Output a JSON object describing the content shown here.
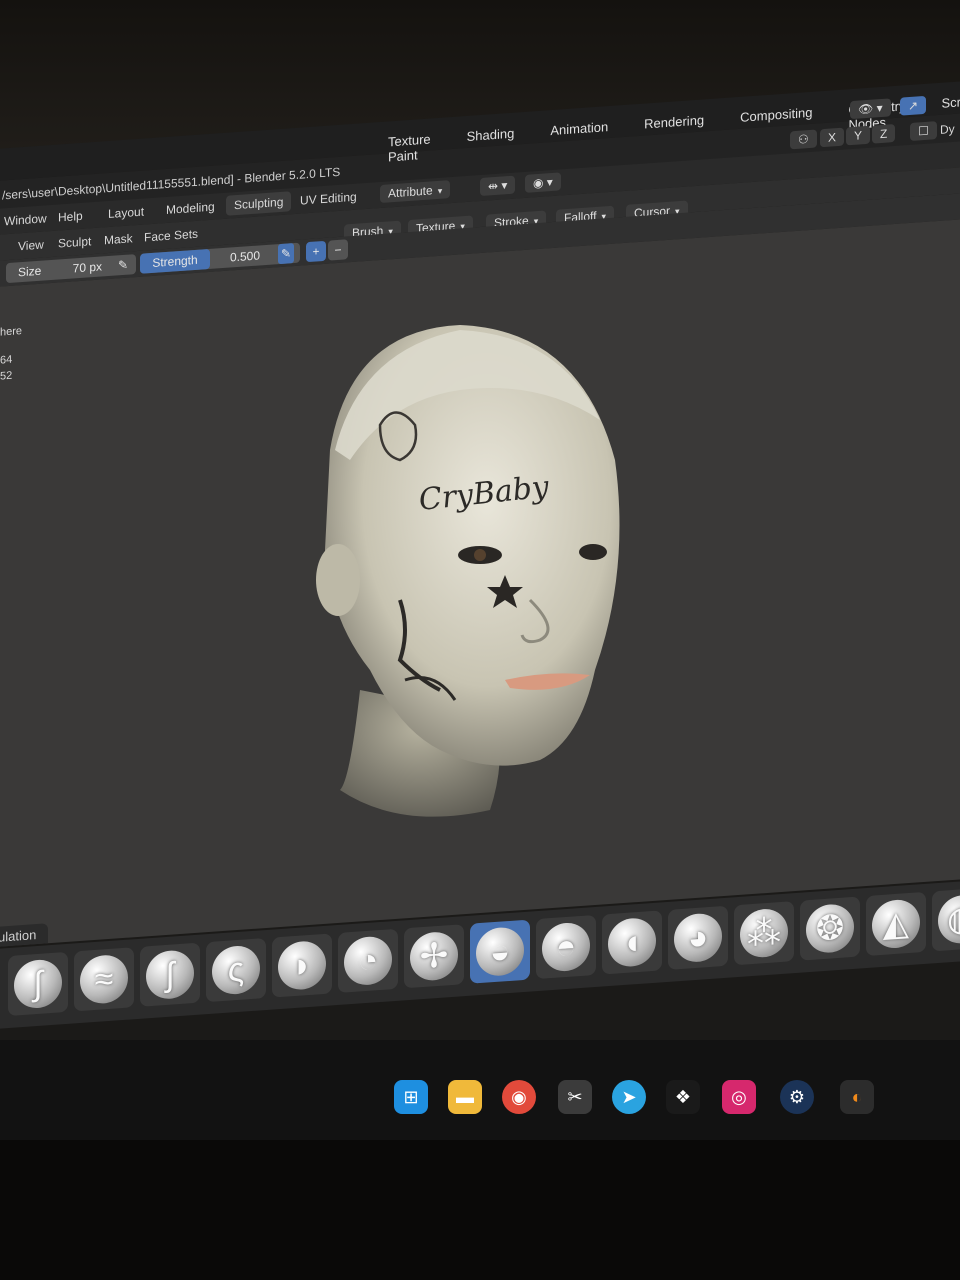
{
  "window": {
    "title": "/sers\\user\\Desktop\\Untitled11155551.blend] - Blender 5.2.0 LTS"
  },
  "workspace_tabs": [
    "Layout",
    "Modeling",
    "Sculpting",
    "UV Editing",
    "Texture Paint",
    "Shading",
    "Animation",
    "Rendering",
    "Compositing",
    "Geometry Nodes",
    "Scripting"
  ],
  "menu": {
    "window": "Window",
    "help": "Help"
  },
  "header": {
    "attribute": "Attribute",
    "axes": [
      "X",
      "Y",
      "Z"
    ],
    "dyntopo": "Dy"
  },
  "mode_menu": [
    "View",
    "Sculpt",
    "Mask",
    "Face Sets"
  ],
  "toolbar": {
    "size_label": "Size",
    "size_value": "70 px",
    "strength_label": "Strength",
    "strength_value": "0.500",
    "plus": "+",
    "minus": "−",
    "brush": "Brush",
    "texture": "Texture",
    "stroke": "Stroke",
    "falloff": "Falloff",
    "cursor": "Cursor"
  },
  "side_panel": {
    "line1": "here",
    "line2": "64",
    "line3": "52"
  },
  "viewport": {
    "tattoo_text": "CryBaby"
  },
  "asset_shelf": {
    "tab_label": "ulation",
    "brush_icons": [
      "snake-hook-icon",
      "draw-sharp-icon",
      "elastic-deform-icon",
      "twist-icon",
      "pose-icon",
      "nudge-icon",
      "rotate-icon",
      "pinch-icon",
      "thumb-icon",
      "boundary-icon",
      "cloth-icon",
      "multiplane-scrape-icon",
      "smooth-icon",
      "layer-icon",
      "displacement-icon"
    ],
    "selected_index": 7
  },
  "taskbar": {
    "icons": [
      "windows-start-icon",
      "file-explorer-icon",
      "chrome-icon",
      "snipping-tool-icon",
      "telegram-icon",
      "figma-icon",
      "instagram-icon",
      "steam-icon",
      "blender-icon"
    ]
  }
}
